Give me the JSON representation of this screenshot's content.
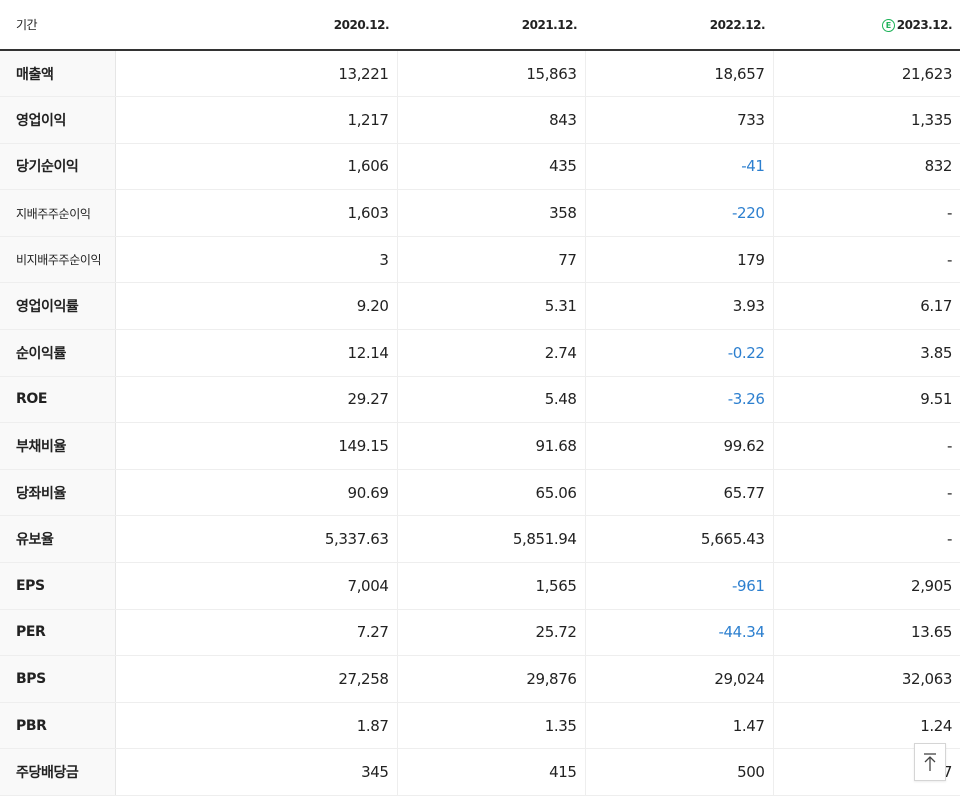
{
  "header": {
    "label": "기간",
    "columns": [
      {
        "period": "2020.12.",
        "estimate": false
      },
      {
        "period": "2021.12.",
        "estimate": false
      },
      {
        "period": "2022.12.",
        "estimate": false
      },
      {
        "period": "2023.12.",
        "estimate": true,
        "estimate_icon": "estimate-icon",
        "estimate_mark": "E"
      }
    ]
  },
  "rows": [
    {
      "label": "매출액",
      "values": [
        "13,221",
        "15,863",
        "18,657",
        "21,623"
      ]
    },
    {
      "label": "영업이익",
      "values": [
        "1,217",
        "843",
        "733",
        "1,335"
      ]
    },
    {
      "label": "당기순이익",
      "values": [
        "1,606",
        "435",
        "-41",
        "832"
      ]
    },
    {
      "label": "지배주주순이익",
      "values": [
        "1,603",
        "358",
        "-220",
        "-"
      ]
    },
    {
      "label": "비지배주주순이익",
      "values": [
        "3",
        "77",
        "179",
        "-"
      ]
    },
    {
      "label": "영업이익률",
      "values": [
        "9.20",
        "5.31",
        "3.93",
        "6.17"
      ]
    },
    {
      "label": "순이익률",
      "values": [
        "12.14",
        "2.74",
        "-0.22",
        "3.85"
      ]
    },
    {
      "label": "ROE",
      "values": [
        "29.27",
        "5.48",
        "-3.26",
        "9.51"
      ]
    },
    {
      "label": "부채비율",
      "values": [
        "149.15",
        "91.68",
        "99.62",
        "-"
      ]
    },
    {
      "label": "당좌비율",
      "values": [
        "90.69",
        "65.06",
        "65.77",
        "-"
      ]
    },
    {
      "label": "유보율",
      "values": [
        "5,337.63",
        "5,851.94",
        "5,665.43",
        "-"
      ]
    },
    {
      "label": "EPS",
      "values": [
        "7,004",
        "1,565",
        "-961",
        "2,905"
      ]
    },
    {
      "label": "PER",
      "values": [
        "7.27",
        "25.72",
        "-44.34",
        "13.65"
      ]
    },
    {
      "label": "BPS",
      "values": [
        "27,258",
        "29,876",
        "29,024",
        "32,063"
      ]
    },
    {
      "label": "PBR",
      "values": [
        "1.87",
        "1.35",
        "1.47",
        "1.24"
      ]
    },
    {
      "label": "주당배당금",
      "values": [
        "345",
        "415",
        "500",
        "7"
      ]
    }
  ],
  "scroll_top_button": {
    "icon": "arrow-up-to-top-icon"
  },
  "colors": {
    "negative": "#2c7fcf",
    "estimate": "#1fb35a",
    "header_rule": "#333333"
  }
}
